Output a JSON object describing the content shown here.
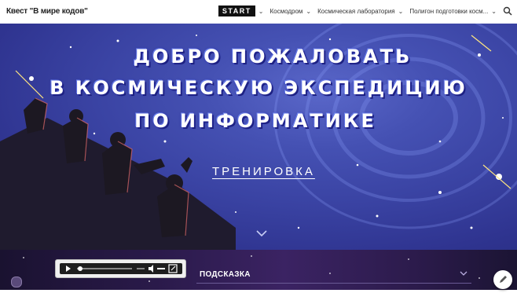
{
  "header": {
    "site_title": "Квест \"В мире кодов\"",
    "nav": [
      {
        "label": "START",
        "active": true
      },
      {
        "label": "Космодром"
      },
      {
        "label": "Космическая лаборатория"
      },
      {
        "label": "Полигон подготовки косм..."
      }
    ],
    "search_icon": "search-icon",
    "chevron_icon": "chevron-down-icon"
  },
  "hero": {
    "title_line1": "ДОБРО ПОЖАЛОВАТЬ",
    "title_line2": "В КОСМИЧЕСКУЮ ЭКСПЕДИЦИЮ",
    "title_line3": "ПО ИНФОРМАТИКЕ",
    "link_label": "ТРЕНИРОВКА",
    "background_colors": [
      "#5a67c9",
      "#262a7c"
    ]
  },
  "audio": {
    "icons": [
      "play-icon",
      "volume-icon",
      "popout-icon"
    ],
    "progress": 0.0
  },
  "hint": {
    "title": "ПОДСКАЗКА"
  },
  "colors": {
    "accent": "#111111",
    "hero_blue": "#3a43a3",
    "bottom_purple": "#3b2363"
  }
}
